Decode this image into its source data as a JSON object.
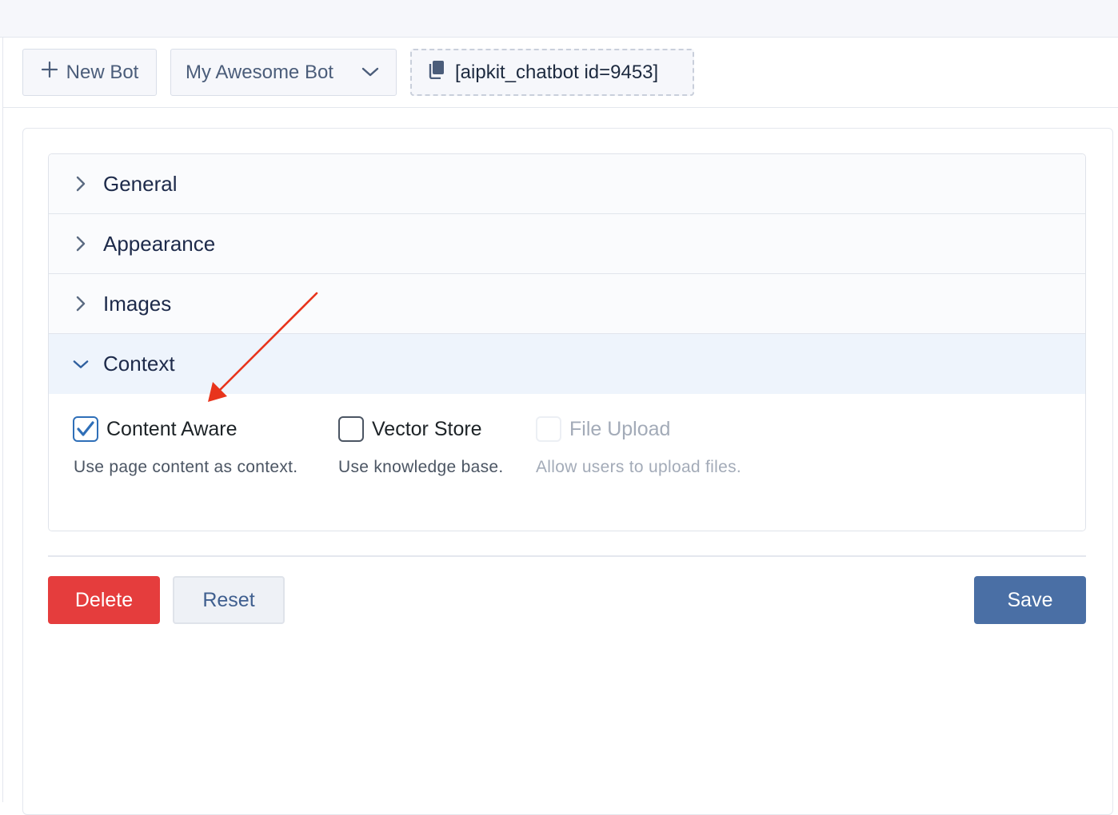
{
  "toolbar": {
    "new_bot_label": "New Bot",
    "bot_select_value": "My Awesome Bot",
    "shortcode": "[aipkit_chatbot id=9453]"
  },
  "accordion": {
    "sections": [
      {
        "label": "General",
        "expanded": false
      },
      {
        "label": "Appearance",
        "expanded": false
      },
      {
        "label": "Images",
        "expanded": false
      },
      {
        "label": "Context",
        "expanded": true
      }
    ],
    "context_options": [
      {
        "label": "Content Aware",
        "description": "Use page content as context.",
        "checked": true,
        "disabled": false
      },
      {
        "label": "Vector Store",
        "description": "Use knowledge base.",
        "checked": false,
        "disabled": false
      },
      {
        "label": "File Upload",
        "description": "Allow users to upload files.",
        "checked": false,
        "disabled": true
      }
    ]
  },
  "actions": {
    "delete_label": "Delete",
    "reset_label": "Reset",
    "save_label": "Save"
  },
  "colors": {
    "delete": "#e53d3d",
    "save": "#4a6fa5",
    "annotation_arrow": "#e8341c"
  }
}
